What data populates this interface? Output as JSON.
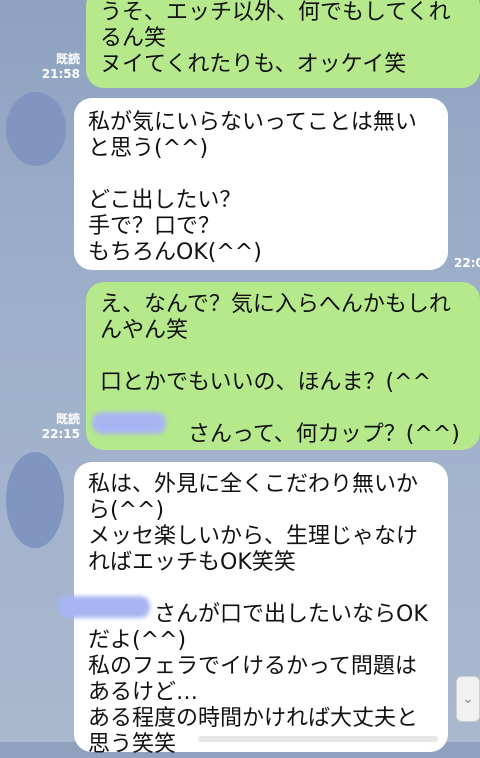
{
  "messages": [
    {
      "type": "sent",
      "text": "うそ、エッチ以外、何でもしてくれるん笑\nヌイてくれたりも、オッケイ笑",
      "read": "既読",
      "time": "21:58"
    },
    {
      "type": "received",
      "text": "私が気にいらないってことは無いと思う(^^)\n\nどこ出したい？\n手で？口で？\nもちろんOK(^^)",
      "time": "22:0"
    },
    {
      "type": "sent",
      "text": "え、なんで？気に入らへんかもしれんやん笑\n\n口とかでもいいの、ほんま？(^^\n\n　　　　さんって、何カップ？(^^)",
      "read": "既読",
      "time": "22:15"
    },
    {
      "type": "received",
      "text": "私は、外見に全くこだわり無いから(^^)\nメッセ楽しいから、生理じゃなければエッチもOK笑笑\n\n　　　さんが口で出したいならOKだよ(^^)\n私のフェラでイけるかって問題はあるけど…\nある程度の時間かければ大丈夫と思う笑笑"
    }
  ],
  "icons": {
    "avatar": "avatar-icon",
    "scroll": "chevron-down-icon"
  }
}
